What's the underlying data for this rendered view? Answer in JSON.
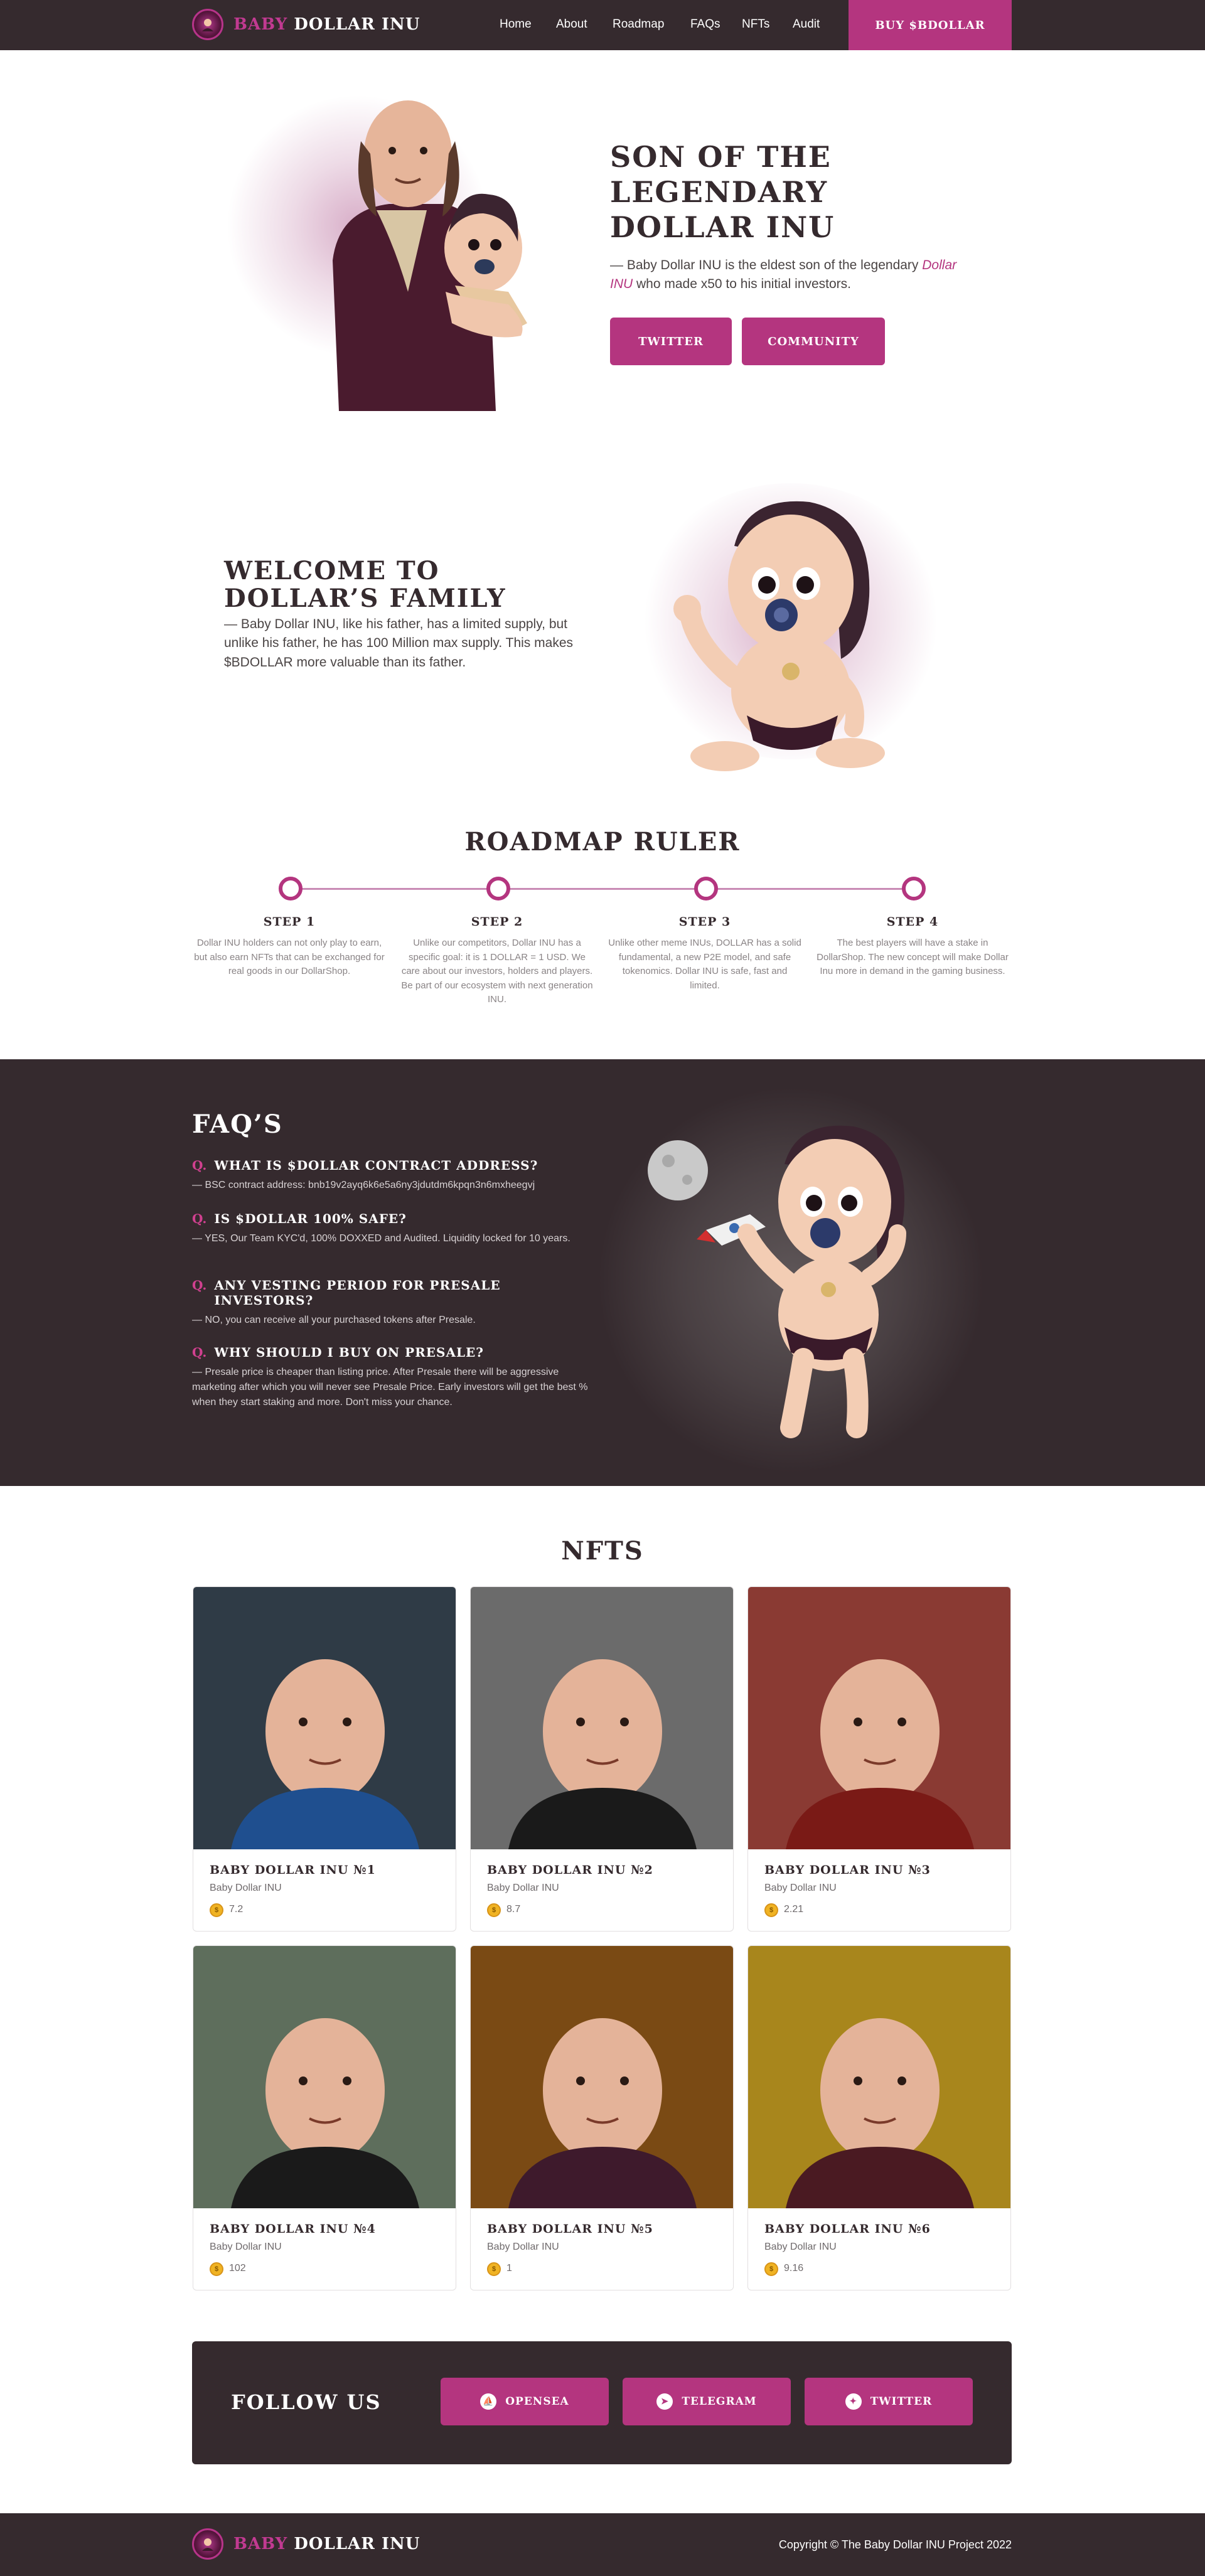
{
  "header": {
    "logo_pink": "BABY",
    "logo_white": "DOLLAR INU",
    "nav": [
      "Home",
      "About",
      "Roadmap",
      "FAQs",
      "NFTs",
      "Audit"
    ],
    "cta": "BUY $BDOLLAR"
  },
  "hero": {
    "title_line1": "SON OF THE",
    "title_line2": "LEGENDARY",
    "title_line3": "DOLLAR INU",
    "text_before": "— Baby Dollar INU is the eldest son of the legendary",
    "text_link": "Dollar INU",
    "text_after": "who made x50 to his initial investors.",
    "buttons": [
      "TWITTER",
      "COMMUNITY"
    ]
  },
  "welcome": {
    "title_line1": "WELCOME TO",
    "title_line2": "DOLLAR’S FAMILY",
    "text": "— Baby Dollar INU, like his father, has a limited supply, but unlike his father, he has 100 Million max supply. This makes $BDOLLAR more valuable than its father."
  },
  "roadmap": {
    "title": "ROADMAP RULER",
    "steps": [
      {
        "title": "STEP 1",
        "text": "Dollar INU holders can not only play to earn, but also earn NFTs that can be exchanged for real goods in our DollarShop."
      },
      {
        "title": "STEP 2",
        "text": "Unlike our competitors, Dollar INU has a specific goal: it is 1 DOLLAR = 1 USD. We care about our investors, holders and players. Be part of our ecosystem with next generation INU."
      },
      {
        "title": "STEP 3",
        "text": "Unlike other meme INUs, DOLLAR has a solid fundamental, a new P2E model, and safe tokenomics. Dollar INU is safe, fast and limited."
      },
      {
        "title": "STEP 4",
        "text": "The best players will have a stake in DollarShop. The new concept will make Dollar Inu more in demand in the gaming business."
      }
    ]
  },
  "faq": {
    "title": "FAQ’S",
    "qmark": "Q.",
    "items": [
      {
        "q": "WHAT IS $DOLLAR CONTRACT ADDRESS?",
        "a": "— BSC contract address: bnb19v2ayq6k6e5a6ny3jdutdm6kpqn3n6mxheegvj"
      },
      {
        "q": "IS $DOLLAR 100% SAFE?",
        "a": "— YES, Our Team KYC'd, 100% DOXXED and Audited. Liquidity locked for 10 years."
      },
      {
        "q": "ANY VESTING PERIOD FOR PRESALE INVESTORS?",
        "a": "— NO, you can receive all your purchased tokens after Presale."
      },
      {
        "q": "WHY SHOULD I BUY ON PRESALE?",
        "a": "— Presale price is cheaper than listing price. After Presale there will be aggressive marketing after which you will never see Presale Price. Early investors will get the best % when they start staking and more. Don't miss your chance."
      }
    ]
  },
  "nfts": {
    "title": "NFTS",
    "items": [
      {
        "name": "BABY DOLLAR INU №1",
        "collection": "Baby Dollar INU",
        "price": "7.2",
        "bg": "#2f3b46",
        "accent": "#1f4f8f"
      },
      {
        "name": "BABY DOLLAR INU №2",
        "collection": "Baby Dollar INU",
        "price": "8.7",
        "bg": "#6b6b6b",
        "accent": "#1a1a1a"
      },
      {
        "name": "BABY DOLLAR INU №3",
        "collection": "Baby Dollar INU",
        "price": "2.21",
        "bg": "#8a3a33",
        "accent": "#7a1a16"
      },
      {
        "name": "BABY DOLLAR INU №4",
        "collection": "Baby Dollar INU",
        "price": "102",
        "bg": "#5e6e5c",
        "accent": "#1a1a1a"
      },
      {
        "name": "BABY DOLLAR INU №5",
        "collection": "Baby Dollar INU",
        "price": "1",
        "bg": "#7a4a14",
        "accent": "#3e1a2c"
      },
      {
        "name": "BABY DOLLAR INU №6",
        "collection": "Baby Dollar INU",
        "price": "9.16",
        "bg": "#a8861c",
        "accent": "#4a1a22"
      }
    ]
  },
  "follow": {
    "title": "FOLLOW US",
    "buttons": [
      "OPENSEA",
      "TELEGRAM",
      "TWITTER"
    ]
  },
  "footer": {
    "logo_pink": "BABY",
    "logo_white": "DOLLAR INU",
    "copyright": "Copyright © The Baby Dollar INU Project 2022"
  },
  "colors": {
    "dark": "#352a2e",
    "accent": "#b4357f"
  }
}
